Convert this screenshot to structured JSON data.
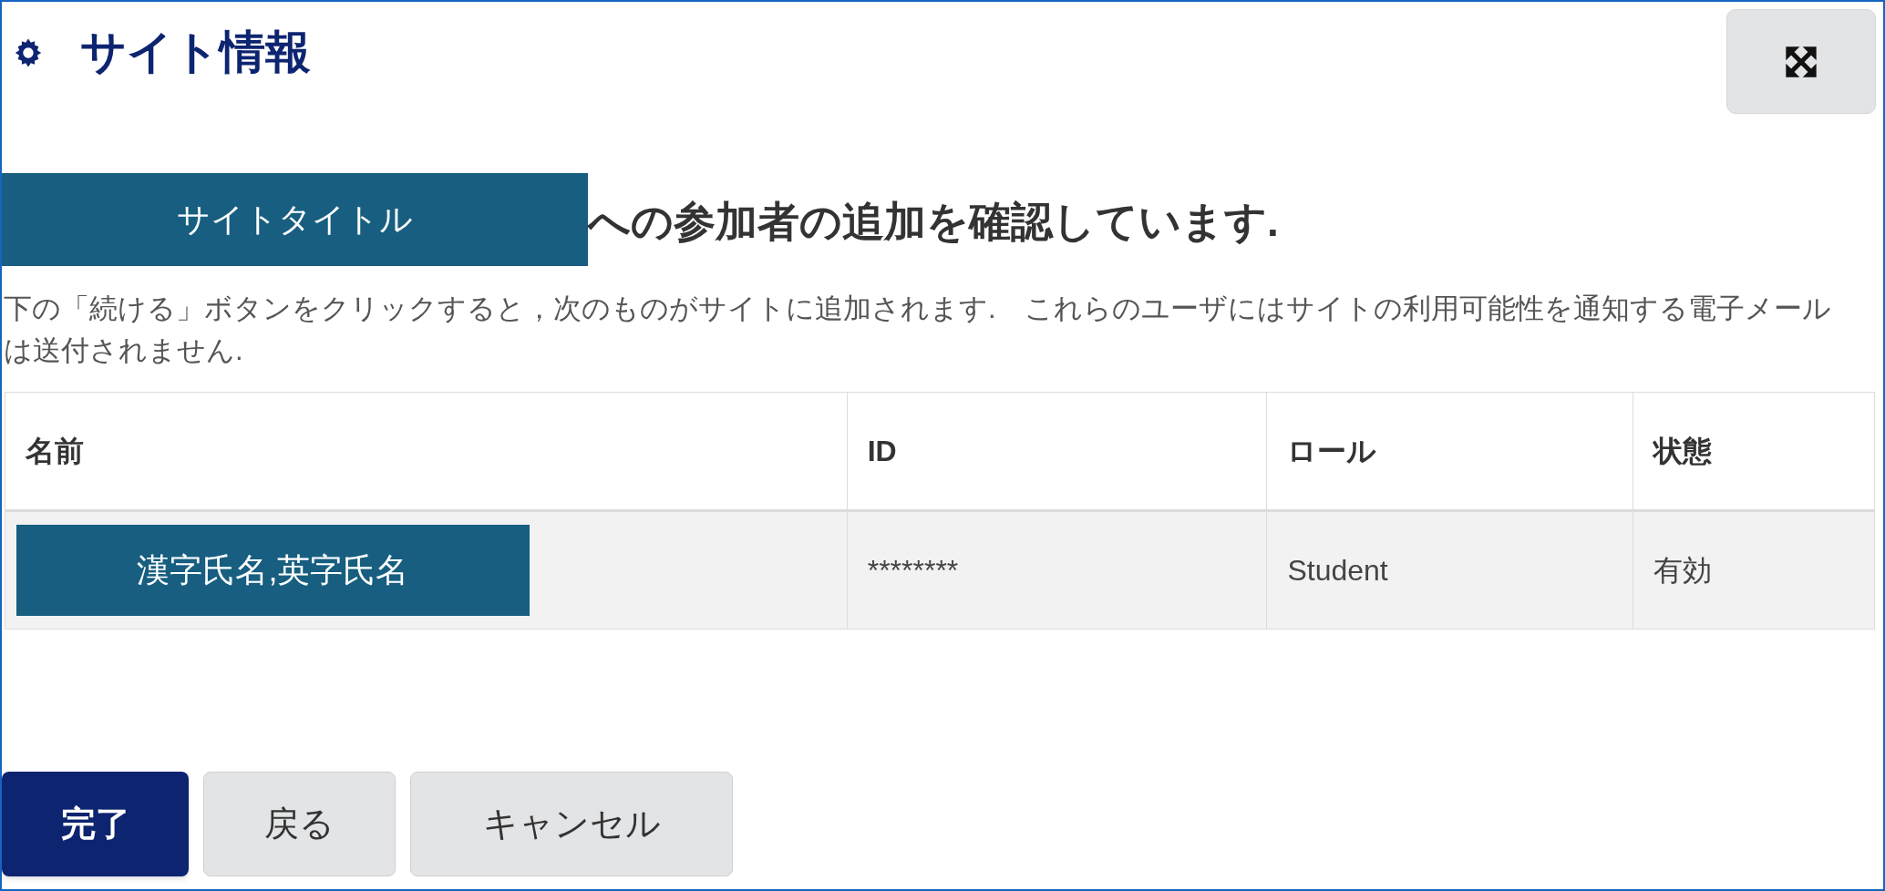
{
  "header": {
    "title": "サイト情報"
  },
  "confirmation": {
    "site_title": "サイトタイトル",
    "heading": "への参加者の追加を確認しています.",
    "description": "下の「続ける」ボタンをクリックすると，次のものがサイトに追加されます.　これらのユーザにはサイトの利用可能性を通知する電子メールは送付されません."
  },
  "table": {
    "columns": [
      "名前",
      "ID",
      "ロール",
      "状態"
    ],
    "rows": [
      {
        "name": "漢字氏名,英字氏名",
        "id": "********",
        "role": "Student",
        "status": "有効"
      }
    ]
  },
  "buttons": [
    {
      "label": "完了",
      "kind": "primary"
    },
    {
      "label": "戻る",
      "kind": "secondary"
    },
    {
      "label": "キャンセル",
      "kind": "secondary"
    }
  ]
}
